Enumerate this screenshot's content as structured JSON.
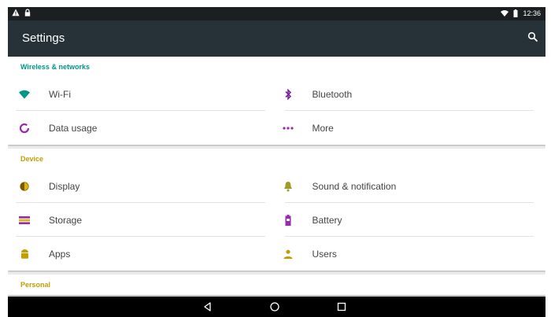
{
  "status_bar": {
    "time": "12:36",
    "icons": [
      "warning-icon",
      "lock-icon",
      "wifi-icon",
      "battery-icon"
    ]
  },
  "app_bar": {
    "title": "Settings",
    "search_icon": "search-icon"
  },
  "sections": [
    {
      "title": "Wireless & networks",
      "title_color": "#009688",
      "items": [
        {
          "label": "Wi-Fi",
          "icon": "wifi-icon",
          "icon_color": "#009688"
        },
        {
          "label": "Bluetooth",
          "icon": "bluetooth-icon",
          "icon_color": "#7b1fa2"
        },
        {
          "label": "Data usage",
          "icon": "data-usage-icon",
          "icon_color": "#9c27b0"
        },
        {
          "label": "More",
          "icon": "more-icon",
          "icon_color": "#9c27b0"
        }
      ]
    },
    {
      "title": "Device",
      "title_color": "#c0a000",
      "items": [
        {
          "label": "Display",
          "icon": "display-icon",
          "icon_color": "#7a5a00"
        },
        {
          "label": "Sound & notification",
          "icon": "bell-icon",
          "icon_color": "#9e9d24"
        },
        {
          "label": "Storage",
          "icon": "storage-icon",
          "icon_color": "#9c27b0"
        },
        {
          "label": "Battery",
          "icon": "battery-icon",
          "icon_color": "#9c27b0"
        },
        {
          "label": "Apps",
          "icon": "android-icon",
          "icon_color": "#c0a000"
        },
        {
          "label": "Users",
          "icon": "user-icon",
          "icon_color": "#c0a000"
        }
      ]
    },
    {
      "title": "Personal",
      "title_color": "#c0a000",
      "items": []
    }
  ],
  "nav_bar": {
    "buttons": [
      "back-icon",
      "home-icon",
      "recents-icon"
    ]
  }
}
